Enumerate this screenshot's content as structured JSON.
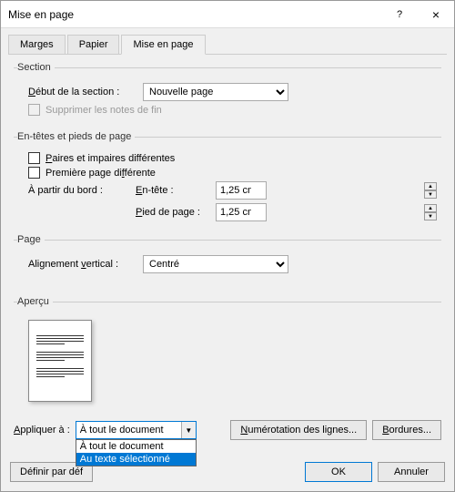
{
  "window": {
    "title": "Mise en page",
    "help_icon": "?",
    "close_icon": "×"
  },
  "tabs": {
    "margins": "Marges",
    "paper": "Papier",
    "layout": "Mise en page"
  },
  "section": {
    "legend": "Section",
    "start_label": "Début de la section :",
    "start_value": "Nouvelle page",
    "suppress_endnotes": "Supprimer les notes de fin"
  },
  "headers_footers": {
    "legend": "En-têtes et pieds de page",
    "odd_even": "Paires et impaires différentes",
    "first_page": "Première page différente",
    "from_edge": "À partir du bord :",
    "header_label": "En-tête :",
    "header_value": "1,25 cm",
    "footer_label": "Pied de page :",
    "footer_value": "1,25 cm"
  },
  "page": {
    "legend": "Page",
    "valign_label": "Alignement vertical :",
    "valign_value": "Centré"
  },
  "preview": {
    "legend": "Aperçu"
  },
  "apply": {
    "label": "Appliquer à :",
    "value": "À tout le document",
    "options": [
      "À tout le document",
      "Au texte sélectionné"
    ],
    "line_numbers": "Numérotation des lignes...",
    "borders": "Bordures..."
  },
  "footer": {
    "set_default": "Définir par déf",
    "ok": "OK",
    "cancel": "Annuler"
  }
}
